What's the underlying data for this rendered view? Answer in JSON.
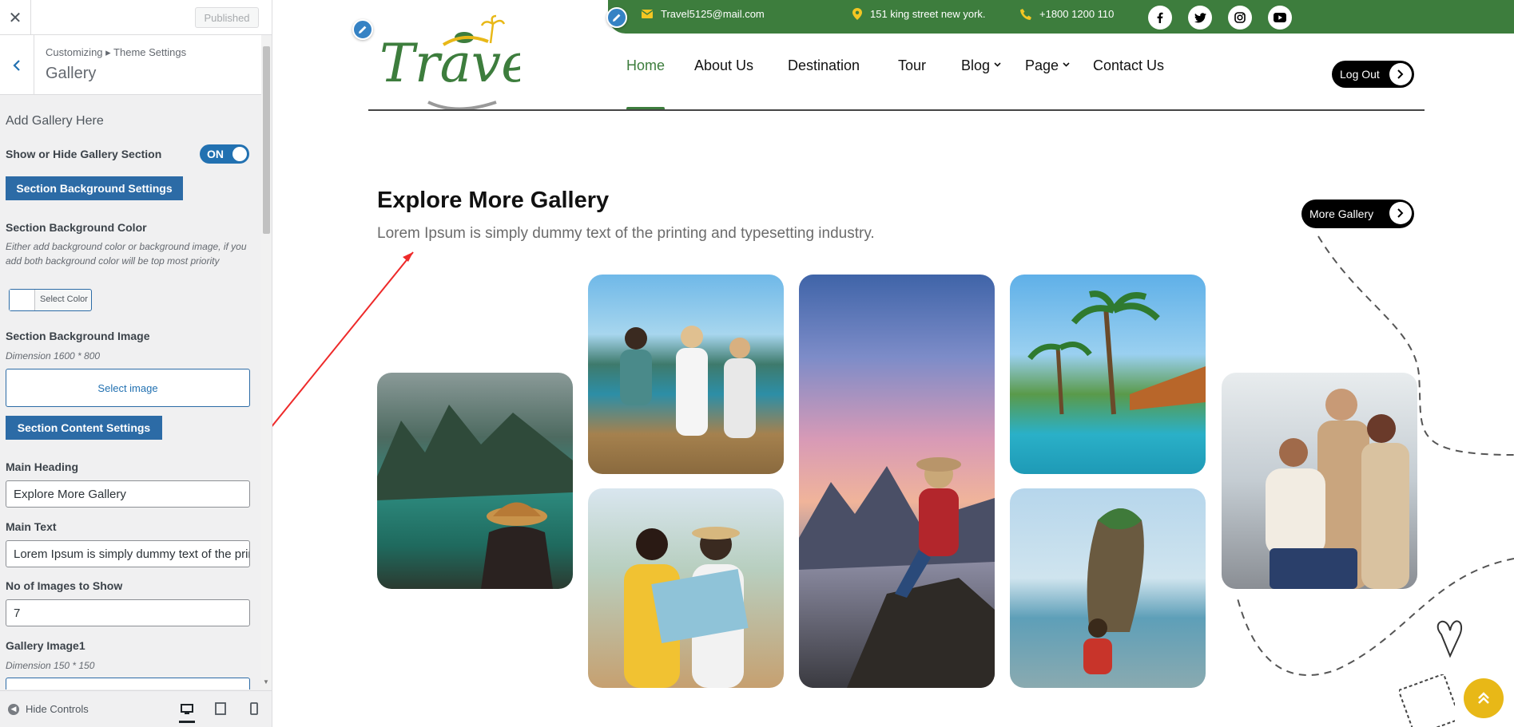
{
  "customizer": {
    "published_label": "Published",
    "breadcrumb": "Customizing ▸ Theme Settings",
    "section_title": "Gallery",
    "add_gallery": "Add Gallery Here",
    "show_hide_label": "Show or Hide Gallery Section",
    "toggle_value": "ON",
    "bg_settings_btn": "Section Background Settings",
    "bg_color_label": "Section Background Color",
    "bg_color_hint": "Either add background color or background image, if you add both background color will be top most priority",
    "select_color": "Select Color",
    "bg_image_label": "Section Background Image",
    "bg_image_dimension": "Dimension 1600 * 800",
    "select_image": "Select image",
    "content_settings_btn": "Section Content Settings",
    "main_heading_label": "Main Heading",
    "main_heading_value": "Explore More Gallery",
    "main_text_label": "Main Text",
    "main_text_value": "Lorem Ipsum is simply dummy text of the printing and typesetting industry.",
    "num_images_label": "No of Images to Show",
    "num_images_value": "7",
    "gallery_image1_label": "Gallery Image1",
    "gallery_image1_dimension": "Dimension 150 * 150",
    "hide_controls": "Hide Controls"
  },
  "site": {
    "email": "Travel5125@mail.com",
    "address": "151 king street new york.",
    "phone": "+1800 1200 110",
    "logo_text": "Travel",
    "nav": {
      "home": "Home",
      "about": "About Us",
      "destination": "Destination",
      "tour": "Tour",
      "blog": "Blog",
      "page": "Page",
      "contact": "Contact Us"
    },
    "logout": "Log Out",
    "gallery_heading": "Explore More Gallery",
    "gallery_text": "Lorem Ipsum is simply dummy text of the printing and typesetting industry.",
    "more_gallery": "More Gallery",
    "social_icons": [
      "facebook-icon",
      "twitter-icon",
      "instagram-icon",
      "youtube-icon"
    ]
  },
  "colors": {
    "brand_green": "#3d7d3d",
    "customizer_blue": "#2c6ba6",
    "accent_yellow": "#e8b817"
  }
}
